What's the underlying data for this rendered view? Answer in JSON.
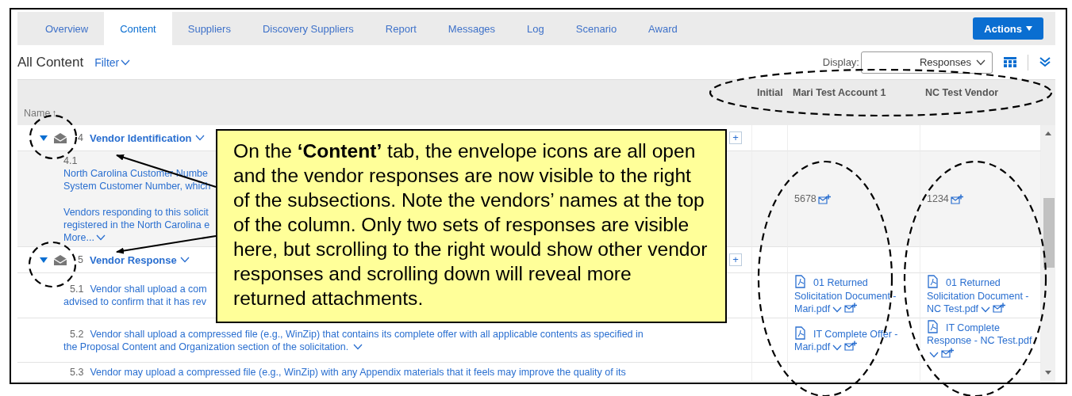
{
  "tabs": [
    {
      "label": "Overview",
      "selected": false
    },
    {
      "label": "Content",
      "selected": true
    },
    {
      "label": "Suppliers",
      "selected": false
    },
    {
      "label": "Discovery Suppliers",
      "selected": false
    },
    {
      "label": "Report",
      "selected": false
    },
    {
      "label": "Messages",
      "selected": false
    },
    {
      "label": "Log",
      "selected": false
    },
    {
      "label": "Scenario",
      "selected": false
    },
    {
      "label": "Award",
      "selected": false
    }
  ],
  "actions_button": "Actions",
  "toolbar": {
    "title": "All Content",
    "filter": "Filter",
    "display_label": "Display:",
    "display_value": "Responses"
  },
  "table": {
    "columns": [
      {
        "label": "Name",
        "sort_indicator": "↑"
      },
      {
        "label": "Initial"
      },
      {
        "label": "Mari Test Account 1"
      },
      {
        "label": "NC Test Vendor"
      }
    ],
    "rows": [
      {
        "kind": "section",
        "number": "4",
        "title": "Vendor Identification",
        "expanded": true,
        "envelope_open": true,
        "add_button": "+"
      },
      {
        "kind": "question",
        "number": "4.1",
        "number_on_own_line": true,
        "paragraphs": [
          [
            "North Carolina Customer Numbe",
            "System Customer Number, which"
          ],
          [
            "Vendors responding to this solicit",
            "registered in the North Carolina e"
          ]
        ],
        "more": "More...",
        "responses": [
          {
            "kind": "value",
            "text": "5678"
          },
          {
            "kind": "value",
            "text": "1234"
          }
        ]
      },
      {
        "kind": "section",
        "number": "5",
        "title": "Vendor Response",
        "expanded": true,
        "envelope_open": true,
        "add_button": "+"
      },
      {
        "kind": "question",
        "number": "5.1",
        "number_on_own_line": false,
        "paragraphs": [
          [
            "Vendor shall upload a com",
            "advised to confirm that it has rev"
          ]
        ],
        "responses": [
          {
            "kind": "attachment",
            "text": "01 Returned Solicitation Document - Mari.pdf"
          },
          {
            "kind": "attachment",
            "text": "01 Returned Solicitation Document - NC Test.pdf"
          }
        ]
      },
      {
        "kind": "question",
        "number": "5.2",
        "number_on_own_line": false,
        "paragraphs": [
          [
            "Vendor shall upload a compressed file (e.g., WinZip) that contains its complete offer with all applicable contents as specified in",
            "the Proposal Content and Organization section of the solicitation."
          ]
        ],
        "expand_chevron": true,
        "responses": [
          {
            "kind": "attachment",
            "text": "IT Complete Offer - Mari.pdf"
          },
          {
            "kind": "attachment",
            "text": "IT Complete Response - NC Test.pdf"
          }
        ]
      },
      {
        "kind": "question",
        "number": "5.3",
        "number_on_own_line": false,
        "paragraphs": [
          [
            "Vendor may upload a compressed file (e.g., WinZip) with any Appendix materials that it feels may improve the quality of its"
          ]
        ]
      }
    ]
  },
  "annotation": {
    "text": "On the **‘Content’** tab, the envelope icons are all open and the vendor responses are now visible to the right of the subsections. Note the vendors’ names at the top of the column. Only two sets of responses are visible here, but scrolling to the right would show other vendor responses and scrolling down will reveal more returned attachments."
  }
}
